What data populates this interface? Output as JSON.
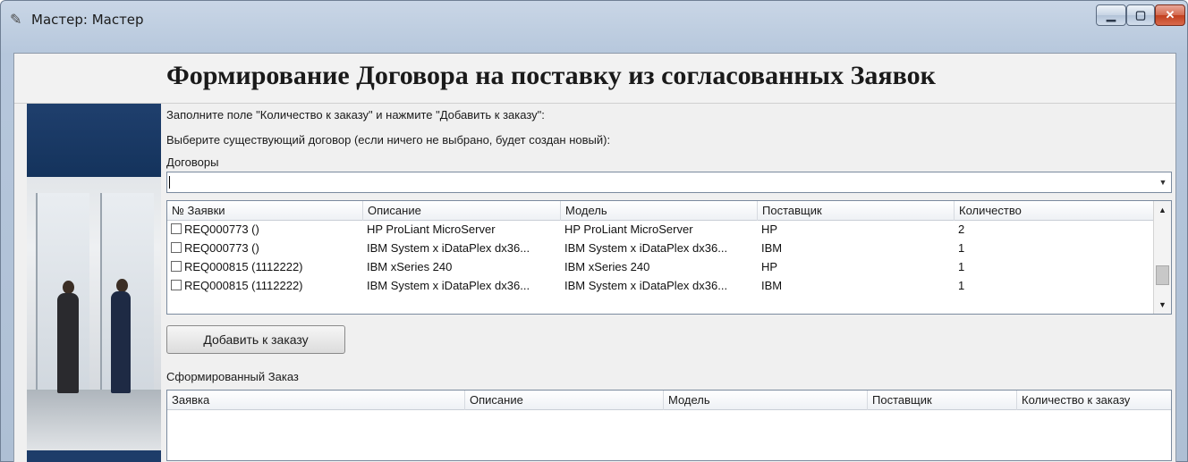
{
  "window": {
    "title": "Мастер: Мастер",
    "icon": "wizard-wand-icon",
    "controls": {
      "minimize": "–",
      "maximize": "▫",
      "close": "X"
    }
  },
  "page": {
    "title": "Формирование Договора на поставку из согласованных Заявок",
    "instruction1": "Заполните поле \"Количество к заказу\" и нажмите \"Добавить к заказу\":",
    "instruction2": "Выберите существующий договор (если ничего не выбрано, будет создан новый):",
    "contracts_label": "Договоры",
    "contracts_value": "",
    "add_button": "Добавить к заказу",
    "order_label": "Сформированный Заказ"
  },
  "requests_grid": {
    "columns": [
      "№ Заявки",
      "Описание",
      "Модель",
      "Поставщик",
      "Количество"
    ],
    "rows": [
      {
        "req": "REQ000773 ()",
        "desc": "HP ProLiant MicroServer",
        "model": "HP ProLiant MicroServer",
        "vendor": "HP",
        "qty": "2"
      },
      {
        "req": "REQ000773 ()",
        "desc": "IBM System x iDataPlex dx36...",
        "model": "IBM System x iDataPlex dx36...",
        "vendor": "IBM",
        "qty": "1"
      },
      {
        "req": "REQ000815 (1112222)",
        "desc": "IBM xSeries 240",
        "model": "IBM xSeries 240",
        "vendor": "HP",
        "qty": "1"
      },
      {
        "req": "REQ000815 (1112222)",
        "desc": "IBM System x iDataPlex dx36...",
        "model": "IBM System x iDataPlex dx36...",
        "vendor": "IBM",
        "qty": "1"
      }
    ]
  },
  "order_grid": {
    "columns": [
      "Заявка",
      "Описание",
      "Модель",
      "Поставщик",
      "Количество к заказу"
    ],
    "rows": []
  },
  "colors": {
    "title_bar": "#b6c7dc",
    "close_button": "#c1401f",
    "side_panel": "#1f3f6d"
  }
}
